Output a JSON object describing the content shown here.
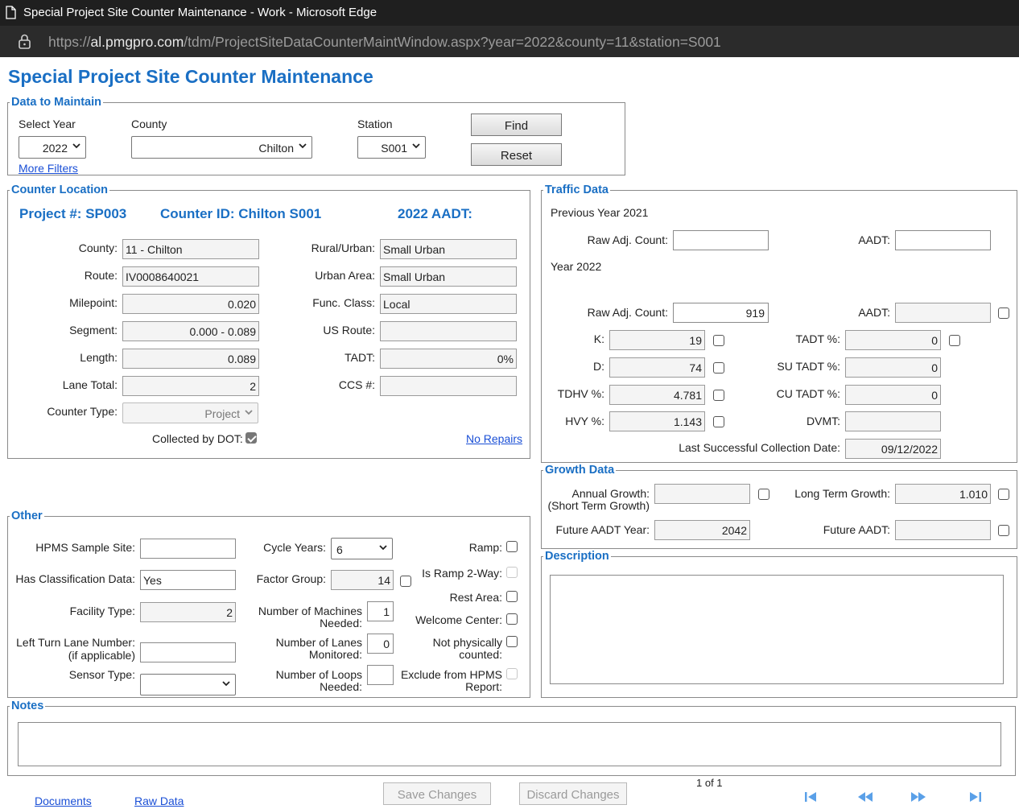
{
  "browser": {
    "window_title": "Special Project Site Counter Maintenance - Work - Microsoft Edge",
    "url_prefix": "https://",
    "url_host": "al.pmgpro.com",
    "url_path": "/tdm/ProjectSiteDataCounterMaintWindow.aspx?year=2022&county=11&station=S001"
  },
  "page_title": "Special Project Site Counter Maintenance",
  "data_to_maintain": {
    "legend": "Data to Maintain",
    "year_label": "Select Year",
    "year_value": "2022",
    "county_label": "County",
    "county_value": "Chilton",
    "station_label": "Station",
    "station_value": "S001",
    "find_label": "Find",
    "reset_label": "Reset",
    "more_filters_label": "More Filters"
  },
  "counter_location": {
    "legend": "Counter Location",
    "project_header": "Project #:  SP003",
    "counter_id_header": "Counter ID: Chilton S001",
    "aadt_header": "2022 AADT:",
    "county_label": "County:",
    "county_value": "11 - Chilton",
    "route_label": "Route:",
    "route_value": "IV0008640021",
    "milepoint_label": "Milepoint:",
    "milepoint_value": "0.020",
    "segment_label": "Segment:",
    "segment_value": "0.000 - 0.089",
    "length_label": "Length:",
    "length_value": "0.089",
    "lane_total_label": "Lane Total:",
    "lane_total_value": "2",
    "counter_type_label": "Counter Type:",
    "counter_type_value": "Project",
    "collected_label": "Collected by DOT:",
    "rural_urban_label": "Rural/Urban:",
    "rural_urban_value": "Small Urban",
    "urban_area_label": "Urban Area:",
    "urban_area_value": "Small Urban",
    "func_class_label": "Func. Class:",
    "func_class_value": "Local",
    "us_route_label": "US Route:",
    "us_route_value": "",
    "tadt_label": "TADT:",
    "tadt_value": "0%",
    "ccs_label": "CCS #:",
    "ccs_value": "",
    "no_repairs_label": "No Repairs"
  },
  "traffic_data": {
    "legend": "Traffic Data",
    "prev_year_label": "Previous Year 2021",
    "raw_adj_label": "Raw Adj. Count:",
    "aadt_label": "AADT:",
    "prev_raw_value": "",
    "prev_aadt_value": "",
    "year_label": "Year 2022",
    "raw_value": "919",
    "aadt_value": "",
    "k_label": "K:",
    "k_value": "19",
    "d_label": "D:",
    "d_value": "74",
    "tdhv_label": "TDHV %:",
    "tdhv_value": "4.781",
    "hvy_label": "HVY %:",
    "hvy_value": "1.143",
    "tadt_pct_label": "TADT %:",
    "tadt_pct_value": "0",
    "su_tadt_label": "SU TADT %:",
    "su_tadt_value": "0",
    "cu_tadt_label": "CU TADT %:",
    "cu_tadt_value": "0",
    "dvmt_label": "DVMT:",
    "dvmt_value": "",
    "last_collection_label": "Last Successful Collection Date:",
    "last_collection_value": "09/12/2022"
  },
  "growth_data": {
    "legend": "Growth Data",
    "annual_growth_label": "Annual Growth:",
    "annual_growth_sub": "(Short Term Growth)",
    "annual_growth_value": "",
    "long_term_label": "Long Term Growth:",
    "long_term_value": "1.010",
    "future_year_label": "Future AADT Year:",
    "future_year_value": "2042",
    "future_aadt_label": "Future AADT:",
    "future_aadt_value": ""
  },
  "other": {
    "legend": "Other",
    "hpms_label": "HPMS Sample Site:",
    "hpms_value": "",
    "class_label": "Has Classification Data:",
    "class_value": "Yes",
    "facility_label": "Facility Type:",
    "facility_value": "2",
    "left_turn_label": "Left Turn Lane Number:",
    "left_turn_sub": "(if applicable)",
    "left_turn_value": "",
    "sensor_label": "Sensor Type:",
    "sensor_value": "",
    "cycle_label": "Cycle Years:",
    "cycle_value": "6",
    "factor_label": "Factor Group:",
    "factor_value": "14",
    "machines_label": "Number of Machines",
    "machines_sub": "Needed:",
    "machines_value": "1",
    "lanes_label": "Number of Lanes",
    "lanes_sub": "Monitored:",
    "lanes_value": "0",
    "loops_label": "Number of Loops",
    "loops_sub": "Needed:",
    "loops_value": "",
    "ramp_label": "Ramp:",
    "ramp2way_label": "Is Ramp 2-Way:",
    "rest_area_label": "Rest Area:",
    "welcome_label": "Welcome Center:",
    "not_phys_label": "Not physically",
    "not_phys_sub": "counted:",
    "exclude_label": "Exclude from HPMS",
    "exclude_sub": "Report:"
  },
  "description": {
    "legend": "Description",
    "value": ""
  },
  "notes": {
    "legend": "Notes",
    "value": ""
  },
  "footer": {
    "documents_label": "Documents",
    "raw_data_label": "Raw Data",
    "save_label": "Save Changes",
    "discard_label": "Discard Changes",
    "pager_text": "1 of 1"
  },
  "colors": {
    "accent": "#1a6fc4",
    "link": "#1a4fd6",
    "nav_icon": "#5aa0e8"
  },
  "icons": [
    "document-icon",
    "lock-icon",
    "chevron-down-icon",
    "first-page-icon",
    "prev-page-icon",
    "next-page-icon",
    "last-page-icon"
  ]
}
